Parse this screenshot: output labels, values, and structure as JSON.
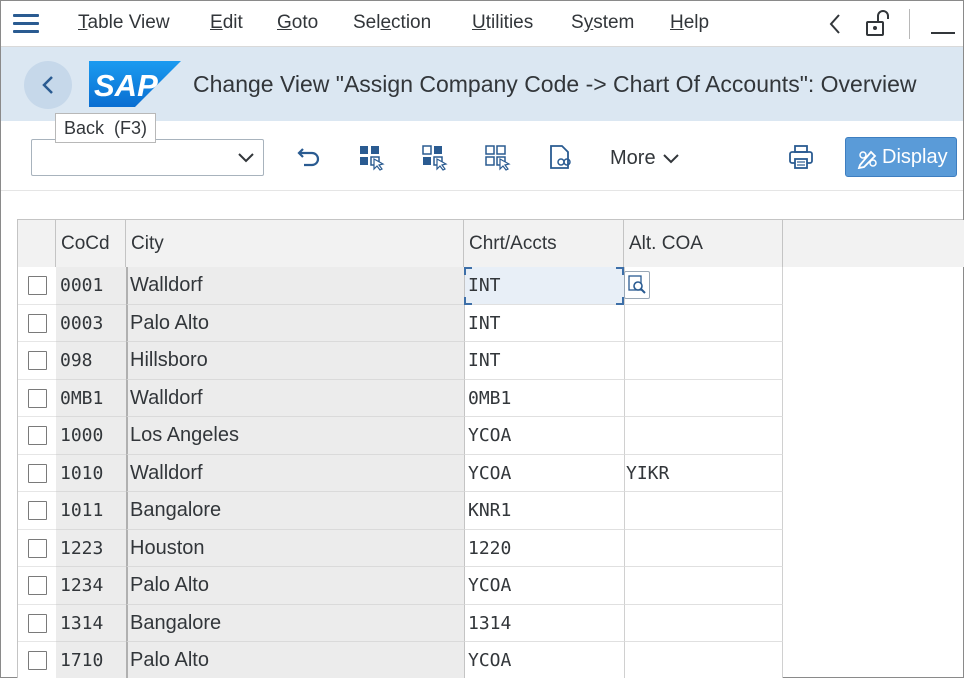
{
  "menu": [
    {
      "label": "Table View",
      "underline": "T",
      "rest": "able View"
    },
    {
      "label": "Edit",
      "underline": "E",
      "rest": "dit"
    },
    {
      "label": "Goto",
      "underline": "G",
      "rest": "oto"
    },
    {
      "label": "Selection",
      "pre": "Sel",
      "underline": "e",
      "rest": "ction"
    },
    {
      "label": "Utilities",
      "underline": "U",
      "rest": "tilities"
    },
    {
      "label": "System",
      "pre": "S",
      "underline": "y",
      "rest": "stem"
    },
    {
      "label": "Help",
      "underline": "H",
      "rest": "elp"
    }
  ],
  "titlebar": {
    "title": "Change View \"Assign Company Code -> Chart Of Accounts\": Overview",
    "logo_text": "SAP",
    "tooltip": "Back  (F3)"
  },
  "toolbar": {
    "more_label": "More",
    "display_label": "Display",
    "combo_value": ""
  },
  "colors": {
    "brand": "#0a6ed1",
    "titlebar_bg": "#dbe7f2",
    "display_button": "#5a9bd8"
  },
  "table": {
    "columns": [
      "CoCd",
      "City",
      "Chrt/Accts",
      "Alt. COA"
    ],
    "rows": [
      {
        "cocd": "0001",
        "city": "Walldorf",
        "coa": "INT",
        "alt": ""
      },
      {
        "cocd": "0003",
        "city": "Palo Alto",
        "coa": "INT",
        "alt": ""
      },
      {
        "cocd": "098",
        "city": "Hillsboro",
        "coa": "INT",
        "alt": ""
      },
      {
        "cocd": "0MB1",
        "city": "Walldorf",
        "coa": "0MB1",
        "alt": ""
      },
      {
        "cocd": "1000",
        "city": "Los Angeles",
        "coa": "YCOA",
        "alt": ""
      },
      {
        "cocd": "1010",
        "city": "Walldorf",
        "coa": "YCOA",
        "alt": "YIKR"
      },
      {
        "cocd": "1011",
        "city": "Bangalore",
        "coa": "KNR1",
        "alt": ""
      },
      {
        "cocd": "1223",
        "city": "Houston",
        "coa": "1220",
        "alt": ""
      },
      {
        "cocd": "1234",
        "city": "Palo Alto",
        "coa": "YCOA",
        "alt": ""
      },
      {
        "cocd": "1314",
        "city": "Bangalore",
        "coa": "1314",
        "alt": ""
      },
      {
        "cocd": "1710",
        "city": "Palo Alto",
        "coa": "YCOA",
        "alt": ""
      }
    ]
  }
}
